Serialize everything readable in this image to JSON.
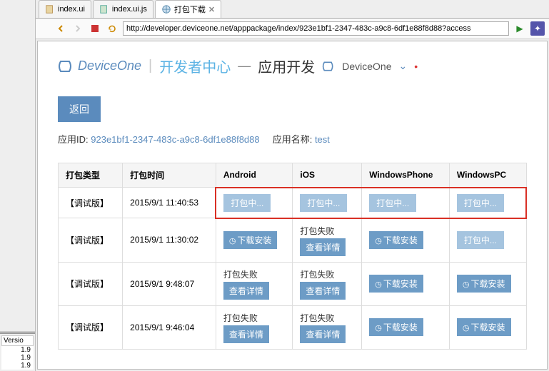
{
  "tabs": [
    {
      "label": "index.ui",
      "icon": "ui"
    },
    {
      "label": "index.ui.js",
      "icon": "js"
    },
    {
      "label": "打包下载",
      "icon": "globe",
      "active": true,
      "closable": true
    }
  ],
  "toolbar": {
    "url": "http://developer.deviceone.net/apppackage/index/923e1bf1-2347-483c-a9c8-6df1e88f8d88?access"
  },
  "brand": {
    "logo": "DeviceOne",
    "cn": "开发者中心",
    "app": "应用开发",
    "small": "DeviceOne"
  },
  "back_label": "返回",
  "info": {
    "app_id_label": "应用ID:",
    "app_id": "923e1bf1-2347-483c-a9c8-6df1e88f8d88",
    "app_name_label": "应用名称:",
    "app_name": "test"
  },
  "table": {
    "headers": [
      "打包类型",
      "打包时间",
      "Android",
      "iOS",
      "WindowsPhone",
      "WindowsPC"
    ],
    "rows": [
      {
        "type": "【调试版】",
        "time": "2015/9/1 11:40:53",
        "cells": [
          "pending",
          "pending",
          "pending",
          "pending"
        ],
        "highlight": true
      },
      {
        "type": "【调试版】",
        "time": "2015/9/1 11:30:02",
        "cells": [
          "download",
          "fail_detail",
          "download",
          "pending"
        ]
      },
      {
        "type": "【调试版】",
        "time": "2015/9/1 9:48:07",
        "cells": [
          "fail_detail",
          "fail_detail",
          "download",
          "download"
        ]
      },
      {
        "type": "【调试版】",
        "time": "2015/9/1 9:46:04",
        "cells": [
          "fail_detail",
          "fail_detail",
          "download",
          "download"
        ]
      }
    ]
  },
  "labels": {
    "pending": "打包中...",
    "download": "下载安装",
    "fail": "打包失败",
    "detail": "查看详情"
  },
  "left_panel": {
    "header": "Versio",
    "items": [
      "1.9",
      "1.9",
      "1.9"
    ]
  }
}
